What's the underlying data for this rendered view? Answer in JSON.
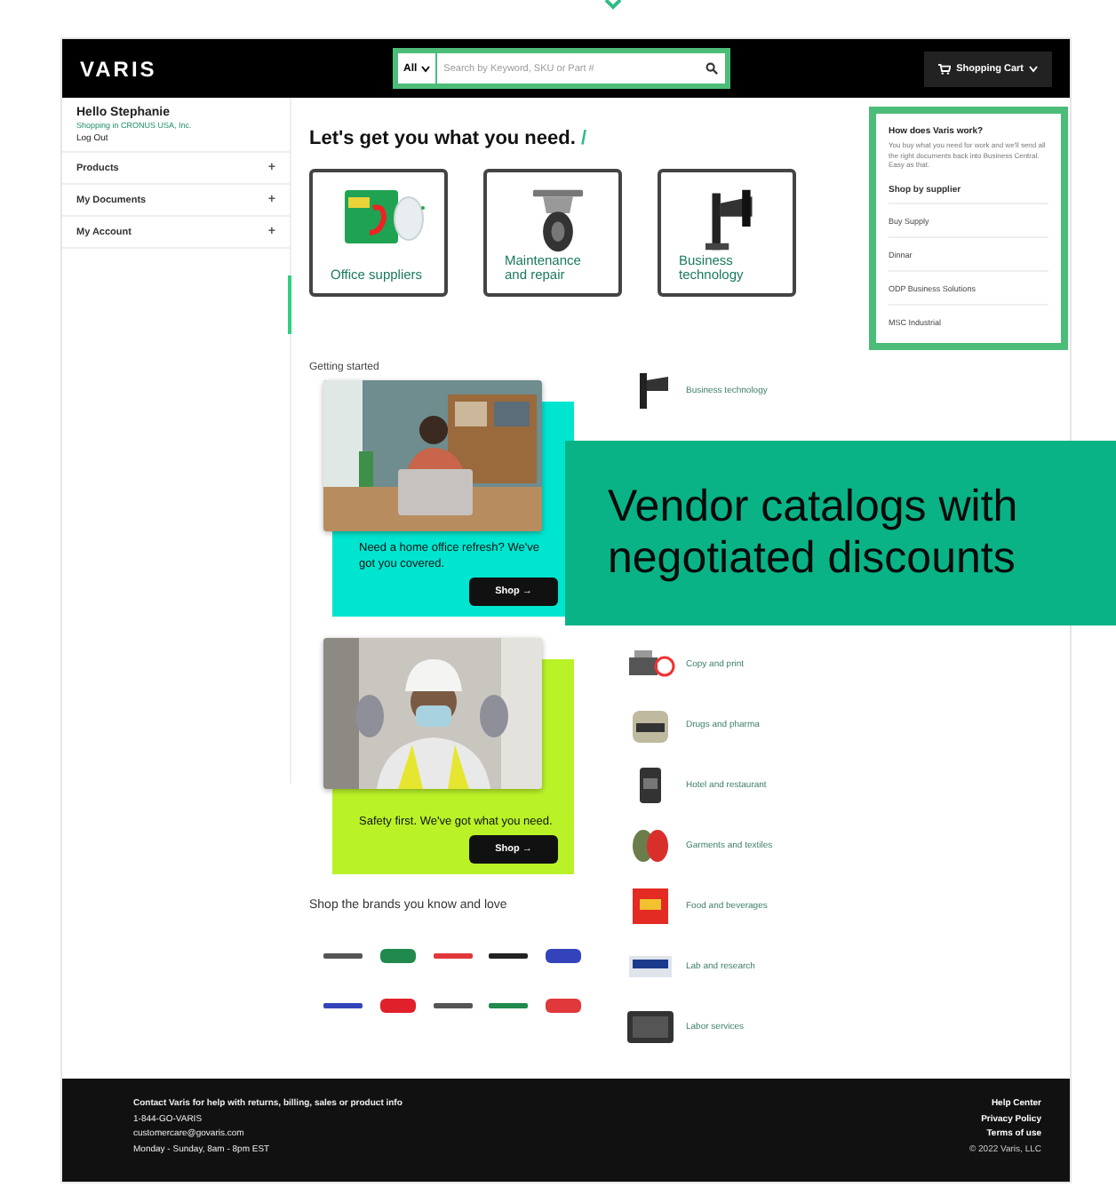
{
  "header": {
    "logo": "VARIS",
    "search": {
      "scope": "All",
      "placeholder": "Search by Keyword, SKU or Part #"
    },
    "cart": "Shopping Cart"
  },
  "sidebar": {
    "greeting": "Hello Stephanie",
    "shopping_in": "Shopping in CRONUS USA, Inc.",
    "logout": "Log Out",
    "items": [
      {
        "label": "Products",
        "toggle": "+"
      },
      {
        "label": "My Documents",
        "toggle": "+"
      },
      {
        "label": "My Account",
        "toggle": "+"
      }
    ]
  },
  "main": {
    "heading": "Let's get you what you need.",
    "accent": "/",
    "cards": [
      {
        "label": "Office suppliers"
      },
      {
        "label": "Maintenance and repair"
      },
      {
        "label": "Business technology"
      }
    ],
    "getting_started": "Getting started",
    "promos": [
      {
        "text": "Need a home office refresh? We've got you covered.",
        "button": "Shop →",
        "color": "#00e5cf"
      },
      {
        "text": "Safety first. We've got what you need.",
        "button": "Shop →",
        "color": "#b9f227"
      }
    ],
    "brands_heading": "Shop the brands you know and love",
    "brands": [
      {
        "color": "#555555"
      },
      {
        "color": "#1f8a4c"
      },
      {
        "color": "#e0383b"
      },
      {
        "color": "#222222"
      },
      {
        "color": "#3344bb"
      },
      {
        "color": "#3344bb"
      },
      {
        "color": "#e0202a"
      },
      {
        "color": "#555555"
      },
      {
        "color": "#1f8a4c"
      },
      {
        "color": "#e0383b"
      }
    ],
    "categories": [
      {
        "label": "Business technology"
      },
      {
        "label": "Copy and print"
      },
      {
        "label": "Drugs and pharma"
      },
      {
        "label": "Hotel and restaurant"
      },
      {
        "label": "Garments and textiles"
      },
      {
        "label": "Food and beverages"
      },
      {
        "label": "Lab and research"
      },
      {
        "label": "Labor services"
      }
    ]
  },
  "info_panel": {
    "title": "How does Varis work?",
    "text": "You buy what you need for work and we'll send all the right documents back into Business Central. Easy as that.",
    "suppliers_heading": "Shop by supplier",
    "suppliers": [
      "Buy Supply",
      "Dinnar",
      "ODP Business Solutions",
      "MSC Industrial"
    ]
  },
  "footer": {
    "contact": [
      "Contact Varis for help with returns, billing, sales or product info",
      "1-844-GO-VARIS",
      "customercare@govaris.com",
      "Monday - Sunday, 8am - 8pm EST"
    ],
    "links": [
      "Help Center",
      "Privacy Policy",
      "Terms of use"
    ],
    "copyright": "© 2022 Varis, LLC"
  },
  "callout": "Vendor catalogs with negotiated discounts"
}
